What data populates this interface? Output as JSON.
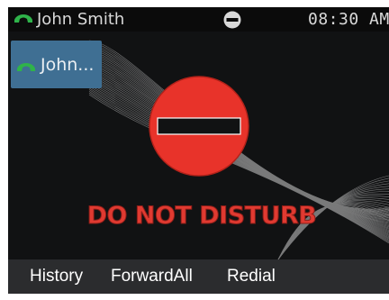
{
  "status_bar": {
    "caller_name": "John Smith",
    "time": "08:30 AM",
    "dnd_indicator": "dnd-icon"
  },
  "line_key": {
    "label": "John...",
    "icon": "handset-icon"
  },
  "main": {
    "dnd_icon": "do-not-disturb-icon",
    "dnd_label": "DO NOT DISTURB"
  },
  "softkeys": [
    {
      "label": "History"
    },
    {
      "label": "ForwardAll"
    },
    {
      "label": "Redial"
    }
  ],
  "colors": {
    "screen_bg": "#111213",
    "line_key_bg": "#3f6f93",
    "handset_green": "#2fb34a",
    "dnd_red": "#e03a31",
    "softkey_bar_bg": "#2b2c2e"
  }
}
